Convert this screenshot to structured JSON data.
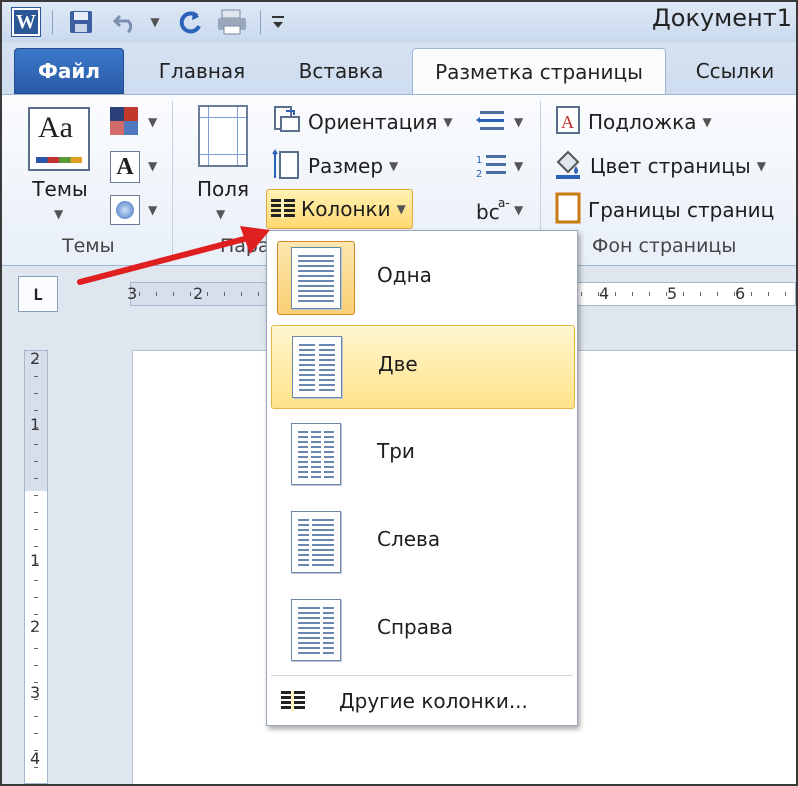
{
  "window": {
    "title": "Документ1"
  },
  "qat": {
    "logo_letter": "W"
  },
  "tabs": [
    {
      "label": "Файл",
      "kind": "file"
    },
    {
      "label": "Главная",
      "kind": "normal"
    },
    {
      "label": "Вставка",
      "kind": "normal"
    },
    {
      "label": "Разметка страницы",
      "kind": "active"
    },
    {
      "label": "Ссылки",
      "kind": "normal"
    }
  ],
  "ribbon": {
    "themes": {
      "button_label": "Темы",
      "group_label": "Темы"
    },
    "page_setup": {
      "margins_label": "Поля",
      "orientation_label": "Ориентация",
      "size_label": "Размер",
      "columns_label": "Колонки",
      "group_label_partial": "Пара"
    },
    "page_background": {
      "watermark_label": "Подложка",
      "page_color_label": "Цвет страницы",
      "page_borders_label": "Границы страниц",
      "group_label": "Фон страницы"
    }
  },
  "ruler": {
    "horizontal_numbers": [
      "3",
      "2",
      "4",
      "5",
      "6"
    ],
    "vertical_numbers": [
      "2",
      "1",
      "1",
      "2",
      "3",
      "4"
    ],
    "tab_selector_glyph": "L"
  },
  "columns_menu": {
    "items": [
      {
        "label": "Одна",
        "columns": 1
      },
      {
        "label": "Две",
        "columns": 2
      },
      {
        "label": "Три",
        "columns": 3
      },
      {
        "label": "Слева",
        "columns": "left"
      },
      {
        "label": "Справа",
        "columns": "right"
      }
    ],
    "more_label": "Другие колонки..."
  },
  "colors": {
    "accent_blue": "#2b5797",
    "file_tab": "#2a5aa8",
    "highlight": "#ffd970",
    "arrow": "#e02020"
  }
}
